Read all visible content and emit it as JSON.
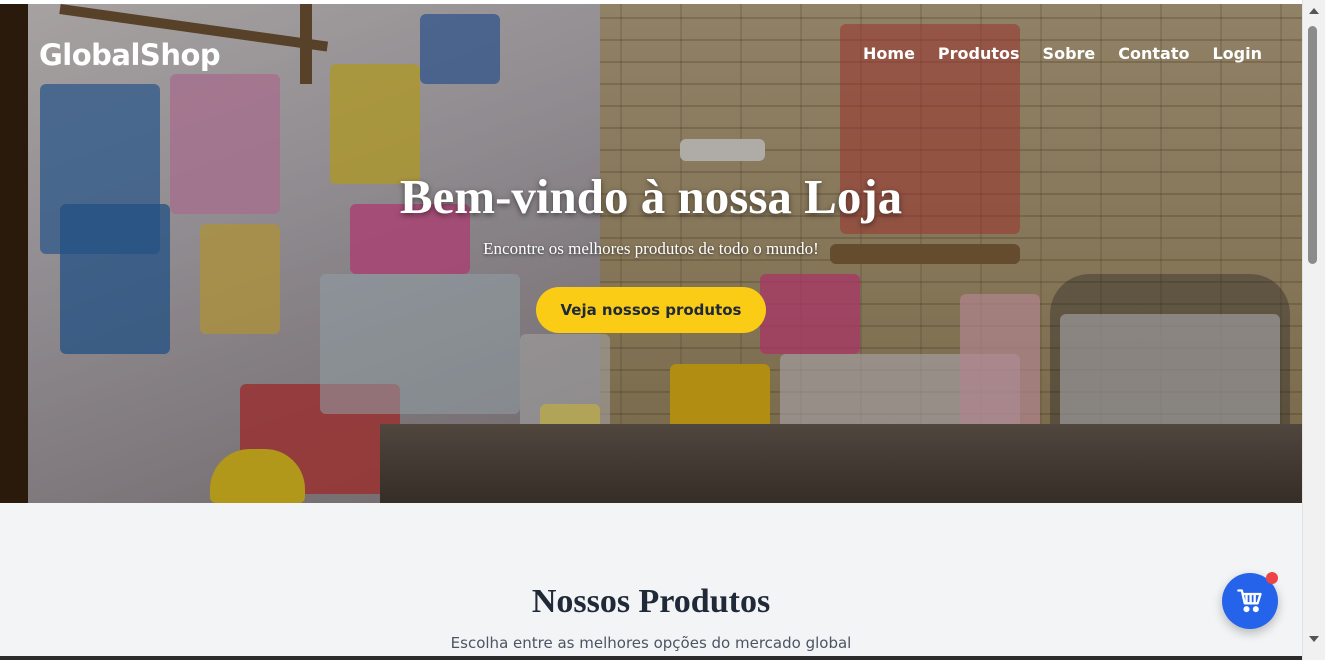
{
  "nav": {
    "brand": "GlobalShop",
    "links": [
      "Home",
      "Produtos",
      "Sobre",
      "Contato",
      "Login"
    ]
  },
  "hero": {
    "title": "Bem-vindo à nossa Loja",
    "subtitle": "Encontre os melhores produtos de todo o mundo!",
    "cta_label": "Veja nossos produtos"
  },
  "products": {
    "title": "Nossos Produtos",
    "subtitle": "Escolha entre as melhores opções do mercado global"
  },
  "cart": {
    "icon": "cart-icon",
    "badge_color": "#ef4444",
    "button_color": "#2563eb"
  },
  "colors": {
    "accent": "#facc15",
    "primary": "#2563eb"
  }
}
